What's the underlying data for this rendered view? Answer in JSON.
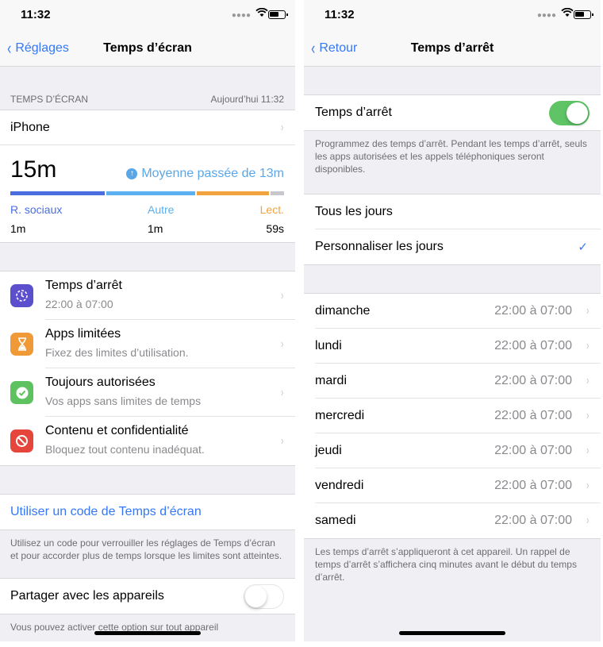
{
  "left": {
    "status": {
      "time": "11:32"
    },
    "nav": {
      "back_label": "Réglages",
      "title": "Temps d’écran"
    },
    "section": {
      "label": "TEMPS D’ÉCRAN",
      "timestamp": "Aujourd’hui 11:32"
    },
    "device": "iPhone",
    "usage": {
      "total": "15m",
      "average": "Moyenne passée de 13m",
      "categories": [
        {
          "label": "R. sociaux",
          "value": "1m",
          "color": "#4a6ee0",
          "share": 0.35
        },
        {
          "label": "Autre",
          "value": "1m",
          "color": "#5cb0ef",
          "share": 0.33
        },
        {
          "label": "Lect.",
          "value": "59s",
          "color": "#f0a33e",
          "share": 0.27
        },
        {
          "label": "",
          "value": "",
          "color": "#c7c7cc",
          "share": 0.05
        }
      ]
    },
    "features": [
      {
        "title": "Temps d’arrêt",
        "subtitle": "22:00 à 07:00",
        "icon": "downtime-icon",
        "color": "#5b4fce"
      },
      {
        "title": "Apps limitées",
        "subtitle": "Fixez des limites d’utilisation.",
        "icon": "hourglass-icon",
        "color": "#f09a37"
      },
      {
        "title": "Toujours autorisées",
        "subtitle": "Vos apps sans limites de temps",
        "icon": "checkmark-seal-icon",
        "color": "#5dc25f"
      },
      {
        "title": "Contenu et confidentialité",
        "subtitle": "Bloquez tout contenu inadéquat.",
        "icon": "restricted-icon",
        "color": "#e5453b"
      }
    ],
    "passcode_link": "Utiliser un code de Temps d’écran",
    "passcode_note": "Utilisez un code pour verrouiller les réglages de Temps d’écran et pour accorder plus de temps lorsque les limites sont atteintes.",
    "share_label": "Partager avec les appareils",
    "share_enabled": false,
    "share_note": "Vous pouvez activer cette option sur tout appareil"
  },
  "right": {
    "status": {
      "time": "11:32"
    },
    "nav": {
      "back_label": "Retour",
      "title": "Temps d’arrêt"
    },
    "downtime_label": "Temps d’arrêt",
    "downtime_enabled": true,
    "downtime_note": "Programmez des temps d’arrêt. Pendant les temps d’arrêt, seuls les apps autorisées et les appels téléphoniques seront disponibles.",
    "schedule_options": [
      {
        "label": "Tous les jours",
        "selected": false
      },
      {
        "label": "Personnaliser les jours",
        "selected": true
      }
    ],
    "days": [
      {
        "day": "dimanche",
        "time": "22:00 à 07:00"
      },
      {
        "day": "lundi",
        "time": "22:00 à 07:00"
      },
      {
        "day": "mardi",
        "time": "22:00 à 07:00"
      },
      {
        "day": "mercredi",
        "time": "22:00 à 07:00"
      },
      {
        "day": "jeudi",
        "time": "22:00 à 07:00"
      },
      {
        "day": "vendredi",
        "time": "22:00 à 07:00"
      },
      {
        "day": "samedi",
        "time": "22:00 à 07:00"
      }
    ],
    "footer_note": "Les temps d’arrêt s’appliqueront à cet appareil. Un rappel de temps d’arrêt s’affichera cinq minutes avant le début du temps d’arrêt."
  }
}
